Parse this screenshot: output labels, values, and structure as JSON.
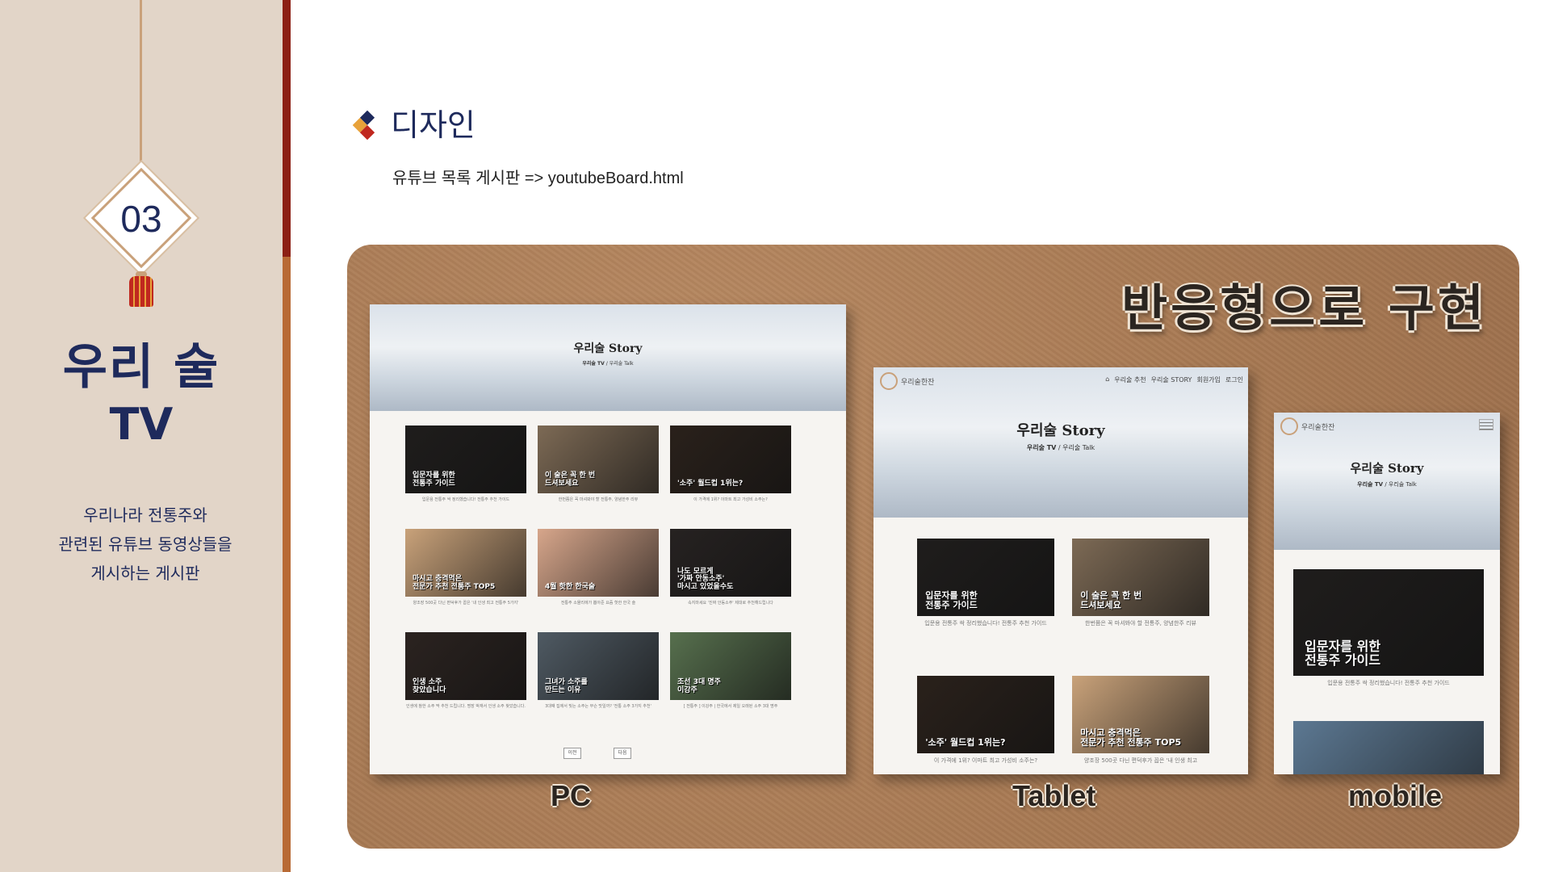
{
  "sidebar": {
    "number": "03",
    "title_line1": "우리 술",
    "title_line2": "TV",
    "description": [
      "우리나라 전통주와",
      "관련된 유튜브 동영상들을",
      "게시하는 게시판"
    ]
  },
  "header": {
    "title": "디자인",
    "subtitle": "유튜브 목록 게시판 => youtubeBoard.html"
  },
  "board": {
    "title": "반응형으로 구현",
    "labels": {
      "pc": "PC",
      "tablet": "Tablet",
      "mobile": "mobile"
    }
  },
  "pc": {
    "hero_title": "우리술 Story",
    "crumb_active": "우리술 TV",
    "crumb_sep": "/",
    "crumb_other": "우리술 Talk",
    "thumbs": [
      {
        "overlay": "입문자를 위한\n전통주 가이드",
        "caption": "입문용 전통주 싹 정리했습니다! 전통주 추천 가이드",
        "bg": "#1f1d1c",
        "color": "#ffffff",
        "accent": "#f2c21b"
      },
      {
        "overlay": "이 술은 꼭 한 번\n드셔보세요",
        "caption": "한번쯤은 꼭 마셔봐야 할 전통주, 양념한주 리뷰",
        "bg": "#7d6a55",
        "color": "#ffffff",
        "accent": "#ffffff"
      },
      {
        "overlay": "'소주' 월드컵 1위는?",
        "caption": "이 가격에 1위? 이마트 최고 가성비 소주는?",
        "bg": "#2a211b",
        "color": "#ffffff",
        "accent": "#f2c21b"
      },
      {
        "overlay": "마시고 충격먹은\n전문가 추천 전통주 TOP5",
        "caption": "양조장 500곳 다닌 편덕후가 꼽은 '내 인생 최고 전통주 5가지'",
        "bg": "#c9a27a",
        "color": "#ffffff",
        "accent": "#222222"
      },
      {
        "overlay": "4월 핫한 한국술",
        "caption": "전통주 소믈리에가 뽑아준 요즘 핫한 한국 술",
        "bg": "#d7a68b",
        "color": "#ffffff",
        "accent": "#f2c21b"
      },
      {
        "overlay": "나도 모르게\n'가짜 안동소주'\n마시고 있었을수도",
        "caption": "속지마세요 '진짜 안동소주' 제대로 추천해드립니다",
        "bg": "#262221",
        "color": "#ffffff",
        "accent": "#f2c21b"
      },
      {
        "overlay": "인생 소주\n찾았습니다",
        "caption": "인생에 참한 소주 딱 추천 드립니다. 명장 박재서 인생 소주 찾았습니다.",
        "bg": "#2b2320",
        "color": "#ffffff",
        "accent": "#f2c21b"
      },
      {
        "overlay": "그녀가 소주를\n만드는 이유",
        "caption": "3대째 집에서 빚는 소주는 무슨 맛일까? '전통 소주 3가지 추천'",
        "bg": "#4f5a63",
        "color": "#ffffff",
        "accent": "#f2c21b"
      },
      {
        "overlay": "조선 3대 명주\n이강주",
        "caption": "[ 전통주 ] 이강주 | 한국에서 제일 오래된 소주 3대 명주",
        "bg": "#57704e",
        "color": "#ffffff",
        "accent": "#f2c21b"
      }
    ],
    "pager": [
      "이전",
      "다음"
    ]
  },
  "tablet": {
    "logo_text": "우리술한잔",
    "nav": [
      "우리술 추천",
      "우리술 STORY",
      "회원가입",
      "로그인"
    ],
    "hero_title": "우리술 Story",
    "crumb_active": "우리술 TV",
    "crumb_sep": "/",
    "crumb_other": "우리술 Talk",
    "thumbs": [
      {
        "overlay": "입문자를 위한\n전통주 가이드",
        "caption": "입문용 전통주 싹 정리했습니다! 전통주 추천 가이드",
        "bg": "#1f1d1c"
      },
      {
        "overlay": "이 술은 꼭 한 번\n드셔보세요",
        "caption": "한번쯤은 꼭 마셔봐야 할 전통주, 양념한주 리뷰",
        "bg": "#7d6a55"
      },
      {
        "overlay": "'소주' 월드컵 1위는?",
        "caption": "이 가격에 1위? 이마트 최고 가성비 소주는?",
        "bg": "#2a211b"
      },
      {
        "overlay": "마시고 충격먹은\n전문가 추천 전통주 TOP5",
        "caption": "양조장 500곳 다닌 편덕후가 꼽은 '내 인생 최고",
        "bg": "#c9a27a"
      }
    ]
  },
  "mobile": {
    "logo_text": "우리술한잔",
    "hero_title": "우리술 Story",
    "crumb_active": "우리술 TV",
    "crumb_sep": "/",
    "crumb_other": "우리술 Talk",
    "thumbs": [
      {
        "overlay": "입문자를 위한\n전통주 가이드",
        "caption": "입문용 전통주 싹 정리했습니다! 전통주 추천 가이드",
        "bg": "#1f1d1c"
      },
      {
        "overlay": "",
        "caption": "",
        "bg": "#5c7892"
      }
    ]
  },
  "colors": {
    "navy": "#1e2a5c",
    "sidebar_bg": "#e2d5c8",
    "stripe_red": "#8c1f14",
    "stripe_orange": "#b86a35",
    "board_brown": "#a87a54",
    "bullet": [
      "#1e2a5c",
      "#c0281f",
      "#e8a23a",
      "#ffffff"
    ]
  }
}
